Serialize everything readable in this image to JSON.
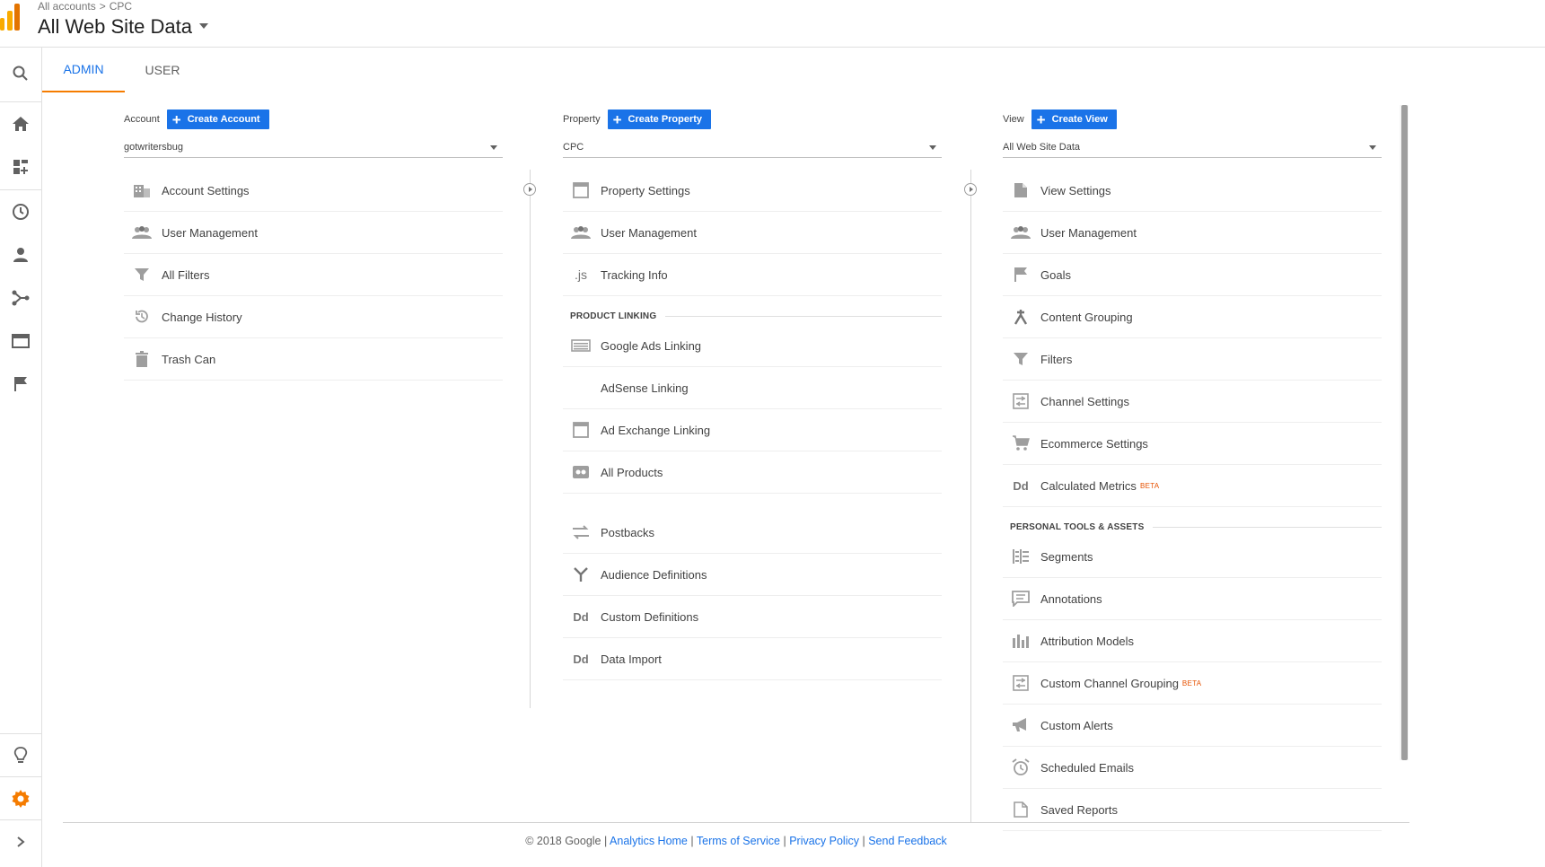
{
  "header": {
    "breadcrumb": [
      "All accounts",
      "CPC"
    ],
    "breadcrumb_sep": ">",
    "title": "All Web Site Data"
  },
  "rail": {
    "icons": [
      "search-icon",
      "home-icon",
      "customization-icon",
      "realtime-clock-icon",
      "audience-person-icon",
      "acquisition-icon",
      "behavior-icon",
      "conversions-flag-icon",
      "discover-bulb-icon",
      "admin-gear-icon",
      "expand-chevron-icon"
    ]
  },
  "tabs": [
    {
      "label": "ADMIN",
      "active": true
    },
    {
      "label": "USER",
      "active": false
    }
  ],
  "account": {
    "label": "Account",
    "create_label": "Create Account",
    "selected": "gotwritersbug",
    "items": [
      {
        "icon": "building-icon",
        "label": "Account Settings"
      },
      {
        "icon": "people-icon",
        "label": "User Management"
      },
      {
        "icon": "filter-icon",
        "label": "All Filters"
      },
      {
        "icon": "history-icon",
        "label": "Change History"
      },
      {
        "icon": "trash-icon",
        "label": "Trash Can"
      }
    ]
  },
  "property": {
    "label": "Property",
    "create_label": "Create Property",
    "selected": "CPC",
    "items": [
      {
        "icon": "window-icon",
        "label": "Property Settings"
      },
      {
        "icon": "people-icon",
        "label": "User Management"
      },
      {
        "icon": "js-icon",
        "glyph": ".js",
        "label": "Tracking Info"
      }
    ],
    "section_label": "PRODUCT LINKING",
    "linking_items": [
      {
        "icon": "ads-icon",
        "label": "Google Ads Linking"
      },
      {
        "icon": "",
        "label": "AdSense Linking"
      },
      {
        "icon": "window-icon",
        "label": "Ad Exchange Linking"
      },
      {
        "icon": "products-icon",
        "label": "All Products"
      }
    ],
    "more_items": [
      {
        "icon": "postbacks-icon",
        "label": "Postbacks"
      },
      {
        "icon": "audience-fork-icon",
        "label": "Audience Definitions"
      },
      {
        "icon": "dd-icon",
        "glyph": "Dd",
        "label": "Custom Definitions"
      },
      {
        "icon": "dd-icon",
        "glyph": "Dd",
        "label": "Data Import"
      }
    ]
  },
  "view": {
    "label": "View",
    "create_label": "Create View",
    "selected": "All Web Site Data",
    "items": [
      {
        "icon": "document-icon",
        "label": "View Settings"
      },
      {
        "icon": "people-icon",
        "label": "User Management"
      },
      {
        "icon": "flag-icon",
        "label": "Goals"
      },
      {
        "icon": "content-grouping-icon",
        "label": "Content Grouping"
      },
      {
        "icon": "filter-icon",
        "label": "Filters"
      },
      {
        "icon": "channel-icon",
        "label": "Channel Settings"
      },
      {
        "icon": "cart-icon",
        "label": "Ecommerce Settings"
      },
      {
        "icon": "dd-icon",
        "glyph": "Dd",
        "label": "Calculated Metrics",
        "badge": "BETA"
      }
    ],
    "section_label": "PERSONAL TOOLS & ASSETS",
    "tools_items": [
      {
        "icon": "segments-icon",
        "label": "Segments"
      },
      {
        "icon": "annotation-icon",
        "label": "Annotations"
      },
      {
        "icon": "bar-chart-icon",
        "label": "Attribution Models"
      },
      {
        "icon": "channel-icon",
        "label": "Custom Channel Grouping",
        "badge": "BETA"
      },
      {
        "icon": "megaphone-icon",
        "label": "Custom Alerts"
      },
      {
        "icon": "alarm-icon",
        "label": "Scheduled Emails"
      },
      {
        "icon": "saved-report-icon",
        "label": "Saved Reports"
      }
    ]
  },
  "footer": {
    "copyright": "© 2018 Google",
    "links": [
      "Analytics Home",
      "Terms of Service",
      "Privacy Policy",
      "Send Feedback"
    ],
    "sep": "|"
  }
}
